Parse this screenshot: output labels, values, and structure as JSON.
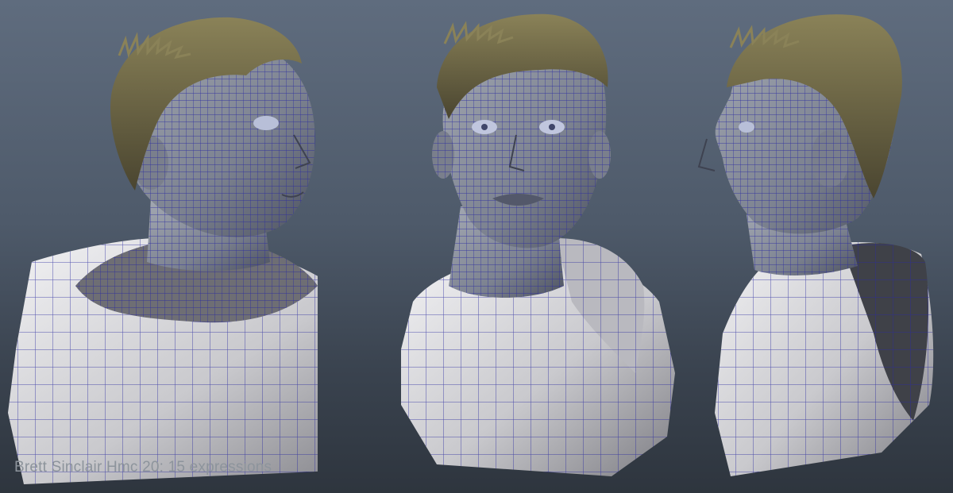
{
  "caption": "Brett Sinclair Hmc 20: 15 expressions",
  "colors": {
    "background_top": "#5f6c7e",
    "background_bottom": "#2e353e",
    "wire": "#2a2aa0",
    "skin": "#8a8f99",
    "cloth": "#d9d9dc",
    "hair": "#6b6443"
  },
  "views": [
    {
      "name": "three-quarter-left"
    },
    {
      "name": "front"
    },
    {
      "name": "profile-left"
    }
  ]
}
